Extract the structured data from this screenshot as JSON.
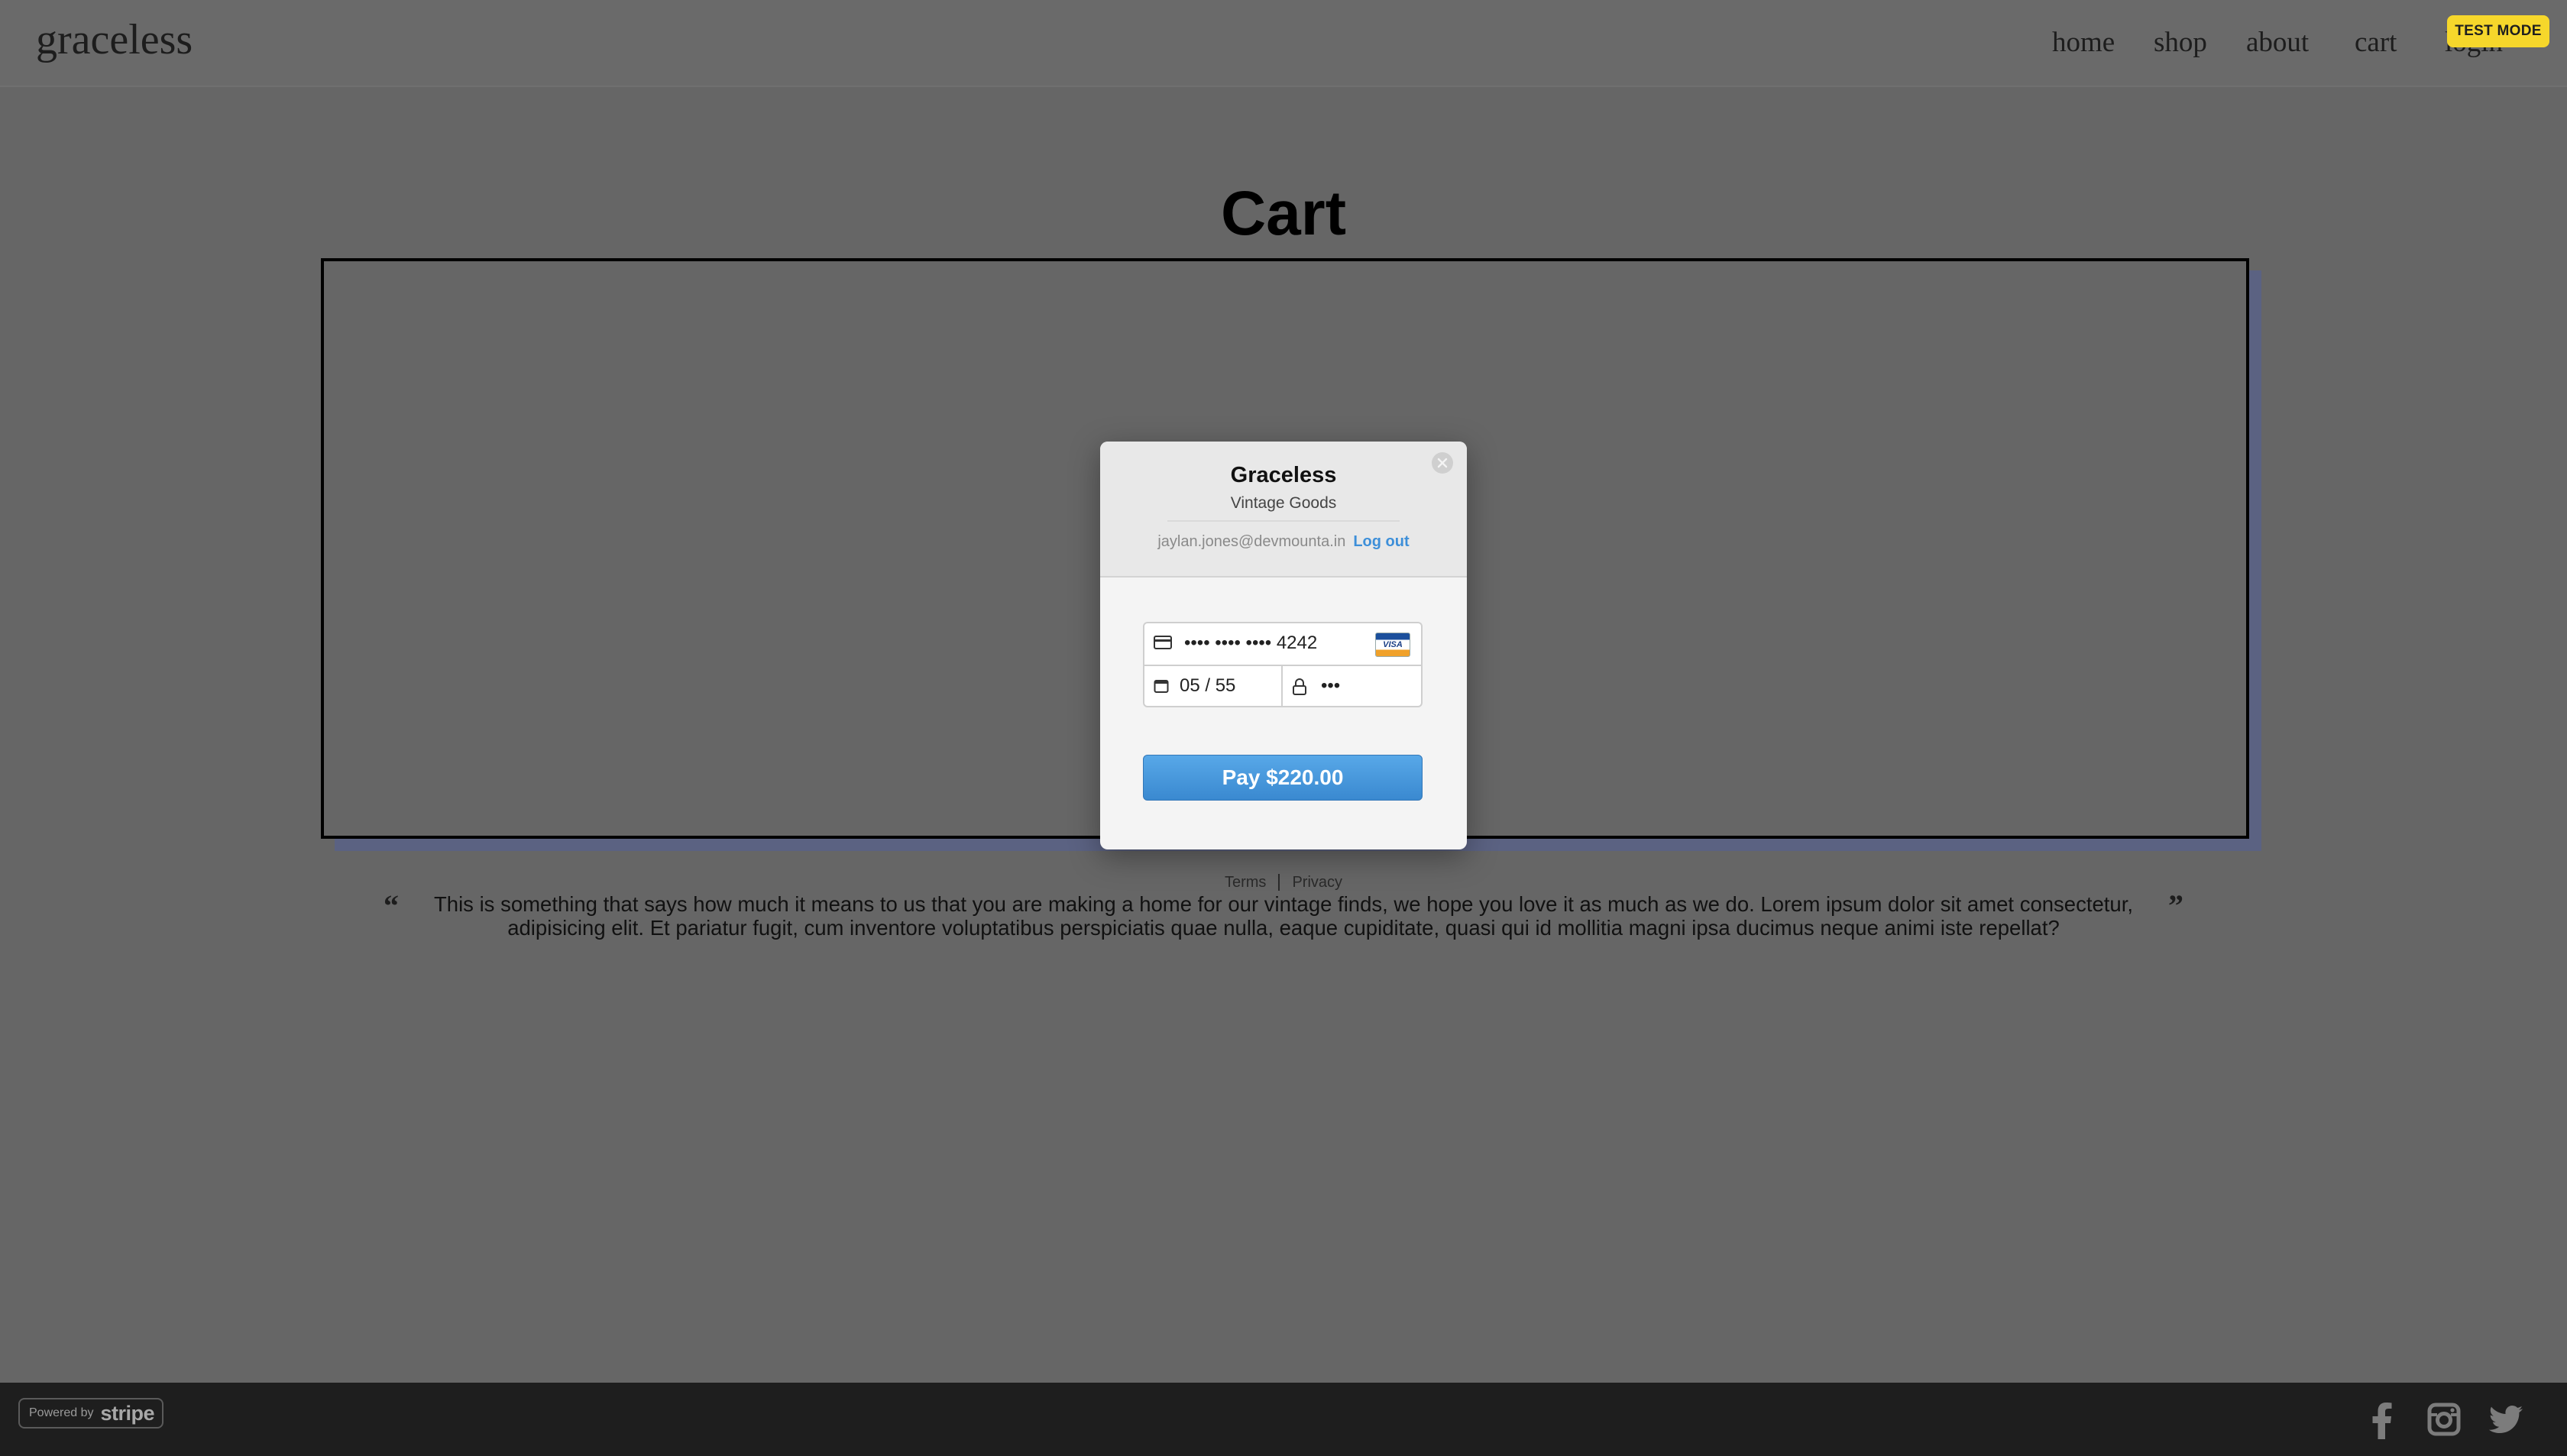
{
  "header": {
    "logo": "graceless",
    "nav": [
      "home",
      "shop",
      "about",
      "cart",
      "login"
    ],
    "test_mode_badge": "TEST MODE"
  },
  "page": {
    "title": "Cart"
  },
  "checkout_modal": {
    "merchant_name": "Graceless",
    "merchant_description": "Vintage Goods",
    "email": "jaylan.jones@devmounta.in",
    "logout_label": "Log out",
    "card_number": "•••• •••• •••• 4242",
    "card_brand": "VISA",
    "expiry": "05 / 55",
    "cvc": "•••",
    "pay_button": "Pay $220.00",
    "accent_color": "#3d8fd9"
  },
  "legal": {
    "terms": "Terms",
    "privacy": "Privacy"
  },
  "quote": {
    "open_mark": "“",
    "text": "This is something that says how much it means to us that you are making a home for our vintage finds, we hope you love it as much as we do. Lorem ipsum dolor sit amet consectetur, adipisicing elit. Et pariatur fugit, cum inventore voluptatibus perspiciatis quae nulla, eaque cupiditate, quasi qui id mollitia magni ipsa ducimus neque animi iste repellat?",
    "close_mark": "”"
  },
  "footer": {
    "powered_by": "Powered by",
    "stripe": "stripe",
    "social_icons": [
      "facebook-icon",
      "instagram-icon",
      "twitter-icon"
    ]
  }
}
